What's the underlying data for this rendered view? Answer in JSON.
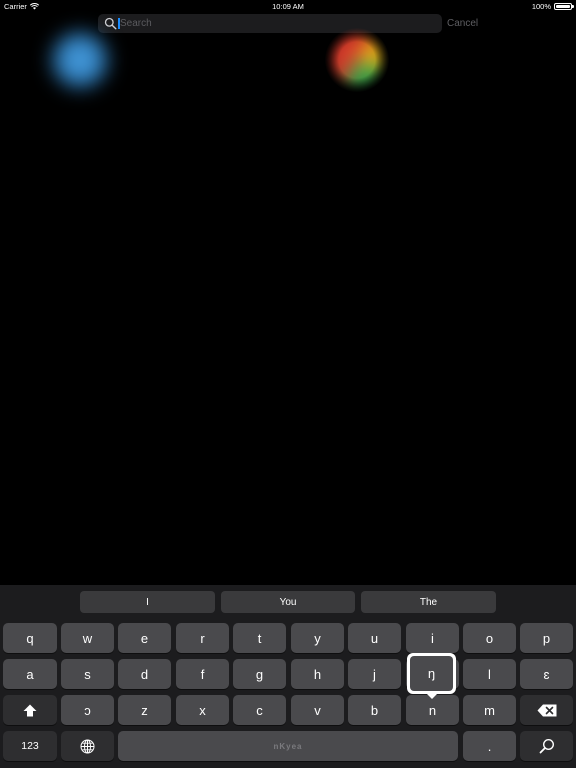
{
  "status_bar": {
    "carrier": "Carrier",
    "time": "10:09 AM",
    "battery": "100%",
    "battery_level": 1.0
  },
  "search": {
    "placeholder": "Search",
    "value": "",
    "cancel_label": "Cancel"
  },
  "suggestions": [
    "I",
    "You",
    "The"
  ],
  "keyboard": {
    "row1": [
      "q",
      "w",
      "e",
      "r",
      "t",
      "y",
      "u",
      "i",
      "o",
      "p"
    ],
    "row2": [
      "a",
      "s",
      "d",
      "f",
      "g",
      "h",
      "j",
      "ŋ",
      "l",
      "ɛ"
    ],
    "row3": [
      "ɔ",
      "z",
      "x",
      "c",
      "v",
      "b",
      "n",
      "m"
    ],
    "numbers_label": "123",
    "period_label": ".",
    "space_label": "nKyea",
    "popup_char": "ŋ"
  },
  "colors": {
    "background": "#000000",
    "keyboard_bg": "#1c1c1e",
    "key": "#4a4a4d",
    "key_dark": "#2e2e30",
    "caret": "#1a8cff"
  }
}
